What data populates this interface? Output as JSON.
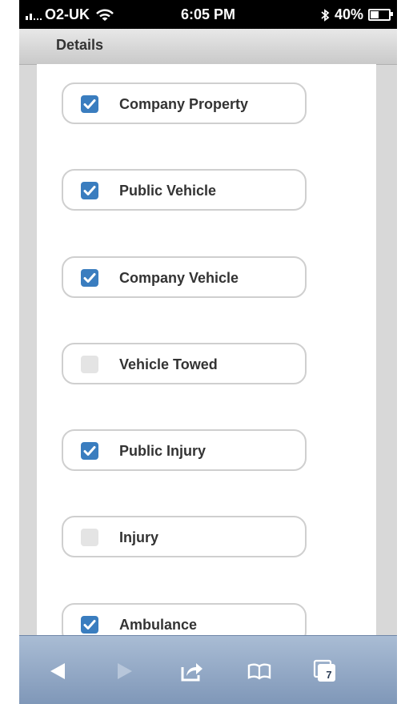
{
  "status_bar": {
    "carrier": "O2-UK",
    "time": "6:05 PM",
    "battery": "40%",
    "battery_level": 0.4
  },
  "header": {
    "title": "Details"
  },
  "options": [
    {
      "label": "Company Property",
      "checked": true
    },
    {
      "label": "Public Vehicle",
      "checked": true
    },
    {
      "label": "Company Vehicle",
      "checked": true
    },
    {
      "label": "Vehicle Towed",
      "checked": false
    },
    {
      "label": "Public Injury",
      "checked": true
    },
    {
      "label": "Injury",
      "checked": false
    },
    {
      "label": "Ambulance",
      "checked": true
    }
  ],
  "toolbar": {
    "back_icon": "back-arrow-icon",
    "forward_icon": "forward-arrow-icon",
    "share_icon": "share-icon",
    "bookmarks_icon": "bookmarks-icon",
    "tabs_icon": "tabs-icon",
    "tabs_count": "7"
  },
  "colors": {
    "checkbox_on": "#3a7dbf",
    "checkbox_off": "#e4e4e4",
    "toolbar": "#8fa6c4"
  }
}
